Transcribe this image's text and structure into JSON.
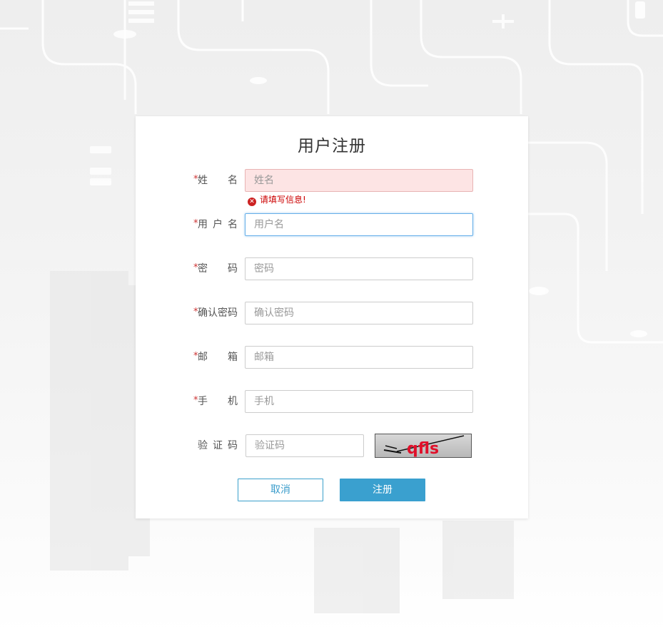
{
  "page": {
    "title": "用户注册"
  },
  "form": {
    "fields": [
      {
        "required_mark": "*",
        "label": "姓名",
        "placeholder": "姓名",
        "value": "",
        "state": "error",
        "error": "请填写信息!"
      },
      {
        "required_mark": "*",
        "label": "用户名",
        "placeholder": "用户名",
        "value": "",
        "state": "focus"
      },
      {
        "required_mark": "*",
        "label": "密码",
        "placeholder": "密码",
        "value": "",
        "state": "normal"
      },
      {
        "required_mark": "*",
        "label": "确认密码",
        "placeholder": "确认密码",
        "value": "",
        "state": "normal"
      },
      {
        "required_mark": "*",
        "label": "邮箱",
        "placeholder": "邮箱",
        "value": "",
        "state": "normal"
      },
      {
        "required_mark": "*",
        "label": "手机",
        "placeholder": "手机",
        "value": "",
        "state": "normal"
      }
    ],
    "captcha": {
      "label": "验证码",
      "placeholder": "验证码",
      "value": "",
      "image_text": "qfls"
    }
  },
  "buttons": {
    "cancel": "取消",
    "submit": "注册"
  },
  "colors": {
    "accent": "#3aa0cf",
    "error": "#cc0000",
    "error_bg": "#fde4e4",
    "required": "#cc3333"
  }
}
